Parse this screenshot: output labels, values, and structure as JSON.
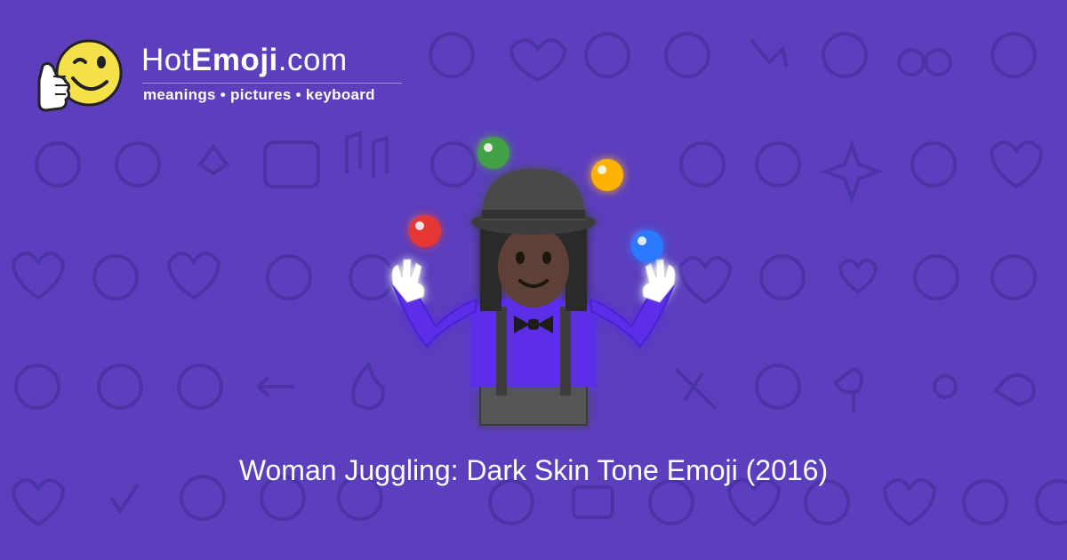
{
  "brand": {
    "name_prefix": "Hot",
    "name_bold": "Emoji",
    "name_suffix": ".com",
    "tagline": "meanings • pictures • keyboard",
    "logo_icon": "thumbs-up-winking-face-icon"
  },
  "main": {
    "emoji_icon": "woman-juggling-dark-skin-tone-icon",
    "caption": "Woman Juggling: Dark Skin Tone Emoji (2016)"
  },
  "colors": {
    "background": "#5b3fbd",
    "pattern": "#4d33a8",
    "text": "#ffffff",
    "ball_red": "#e53935",
    "ball_green": "#43a047",
    "ball_yellow": "#ffb300",
    "ball_blue": "#2979ff",
    "shirt": "#5b2ee8",
    "hat": "#4a4a4a",
    "skin": "#5d4037"
  }
}
